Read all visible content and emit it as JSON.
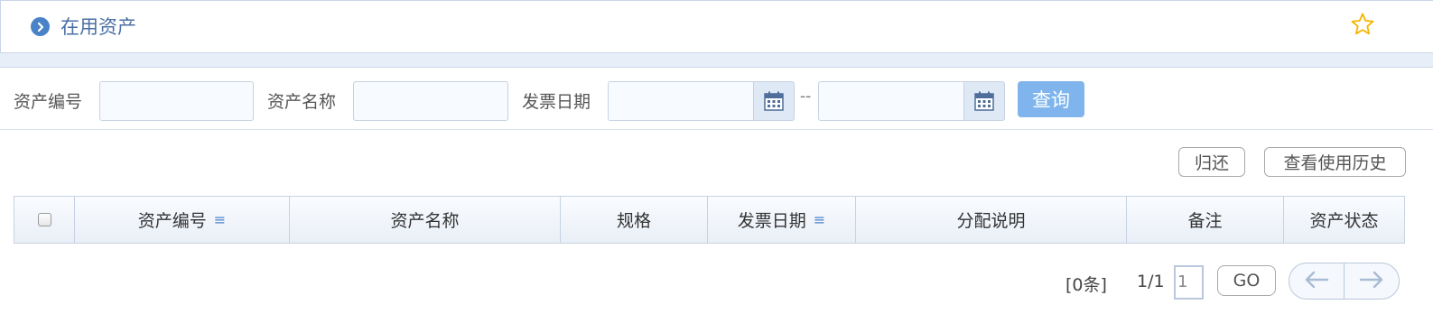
{
  "header": {
    "title": "在用资产"
  },
  "filters": {
    "asset_no_label": "资产编号",
    "asset_name_label": "资产名称",
    "invoice_date_label": "发票日期",
    "date_separator": "--",
    "query_label": "查询"
  },
  "toolbar": {
    "return_label": "归还",
    "history_label": "查看使用历史"
  },
  "table": {
    "columns": [
      "资产编号",
      "资产名称",
      "规格",
      "发票日期",
      "分配说明",
      "备注",
      "资产状态"
    ]
  },
  "pager": {
    "count_text": "[0条]",
    "page_text": "1/1",
    "page_input": "1",
    "go_label": "GO"
  },
  "colors": {
    "accent": "#4a82c8",
    "query_button": "#7fb5ec",
    "star": "#f5b500"
  }
}
